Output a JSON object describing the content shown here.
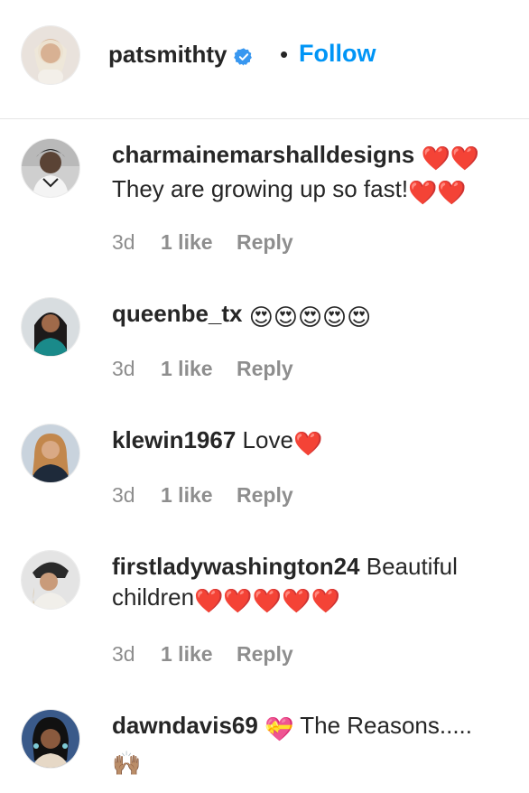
{
  "post": {
    "author": "patsmithty",
    "follow_label": "Follow",
    "separator": "•"
  },
  "colors": {
    "accent": "#0095f6",
    "text": "#262626",
    "muted": "#8e8e8e",
    "divider": "#e6e6e6"
  },
  "comments": [
    {
      "username": "charmainemarshalldesigns",
      "text": "They are growing up so fast!",
      "emojis_after_name": "❤️❤️",
      "emojis_after_text": "❤️❤️",
      "time": "3d",
      "likes": "1 like",
      "reply": "Reply"
    },
    {
      "username": "queenbe_tx",
      "text": "",
      "emojis_after_name": "😍😍😍😍😍",
      "time": "3d",
      "likes": "1 like",
      "reply": "Reply"
    },
    {
      "username": "klewin1967",
      "text": "Love",
      "emojis_after_text": "❤️",
      "time": "3d",
      "likes": "1 like",
      "reply": "Reply"
    },
    {
      "username": "firstladywashington24",
      "text": "Beautiful children",
      "emojis_after_text": "❤️❤️❤️❤️❤️",
      "time": "3d",
      "likes": "1 like",
      "reply": "Reply"
    },
    {
      "username": "dawndavis69",
      "emoji_before_text": "💝",
      "text": "The Reasons.....",
      "emojis_after_text": "🙌🏽"
    }
  ],
  "icons": {
    "verified": "verified-badge-icon"
  }
}
